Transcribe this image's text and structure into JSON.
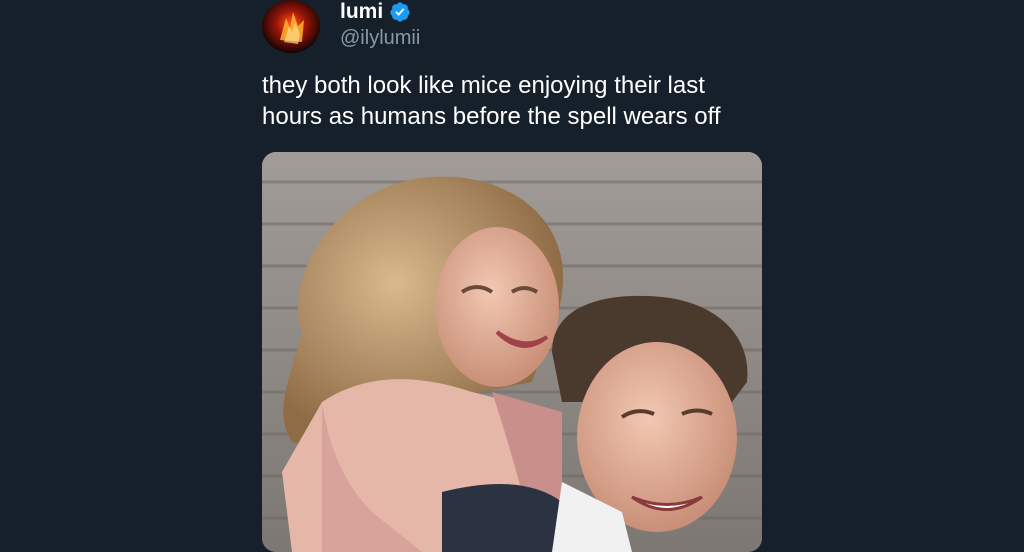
{
  "tweet": {
    "author": {
      "display_name": "lumi",
      "handle": "@ilylumii",
      "verified": true,
      "verified_icon": "verified-badge-icon",
      "avatar": "avatar-image"
    },
    "text_line_1": "they both look like mice enjoying their last",
    "text_line_2": "hours as humans before the spell wears off",
    "media": {
      "type": "photo",
      "description_icon": "photo-image"
    }
  },
  "colors": {
    "background": "#15202b",
    "primary_text": "#ffffff",
    "secondary_text": "#8899a6",
    "verified_blue": "#1d9bf0"
  }
}
